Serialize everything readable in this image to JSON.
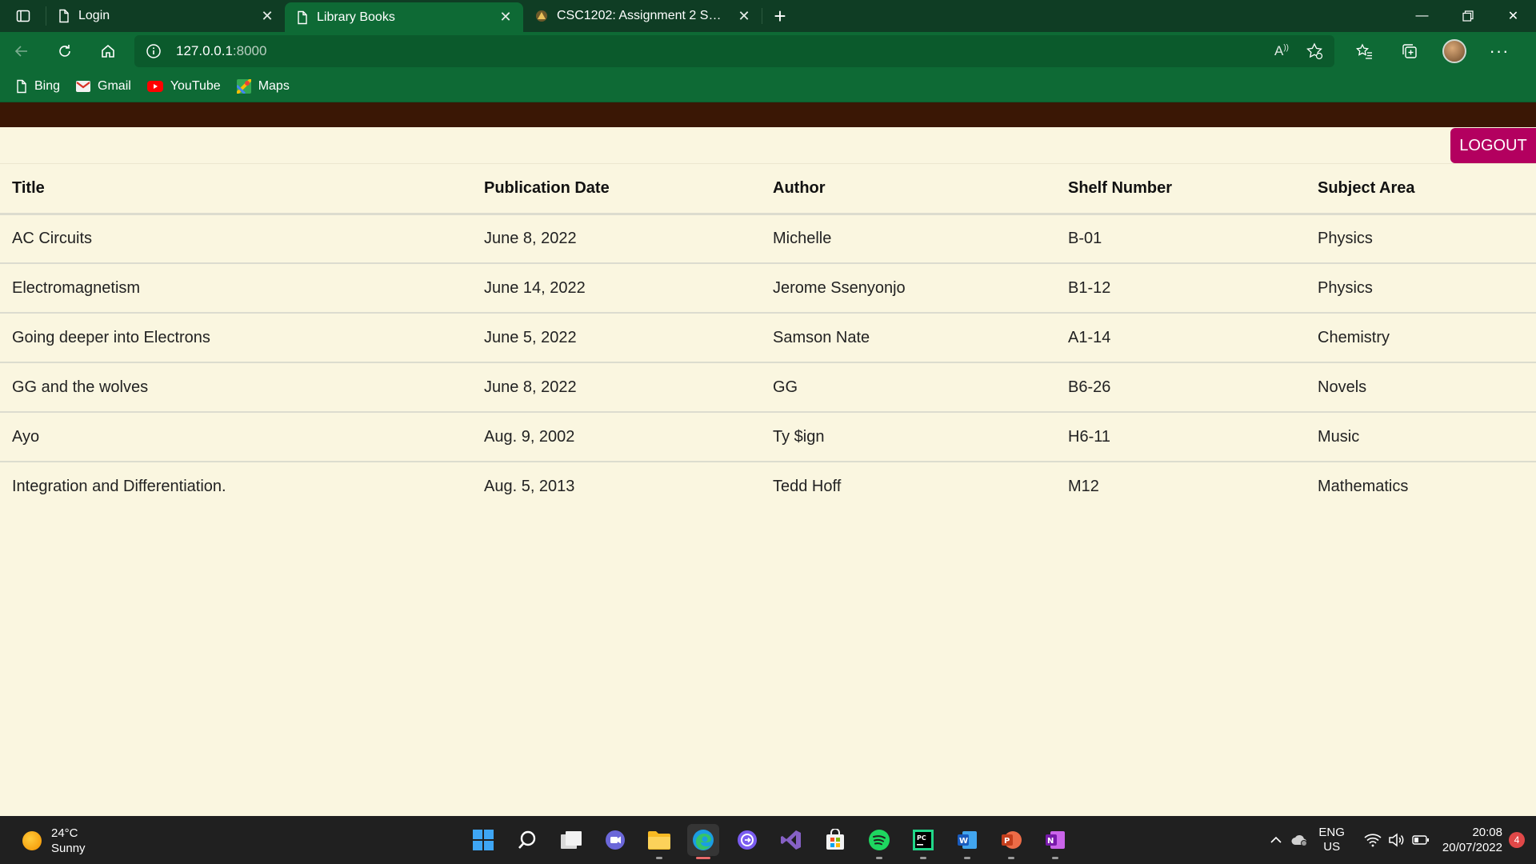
{
  "browser": {
    "tabs": [
      {
        "title": "Login",
        "active": false
      },
      {
        "title": "Library Books",
        "active": true
      },
      {
        "title": "CSC1202: Assignment 2 Submiss",
        "active": false
      }
    ],
    "address": {
      "host": "127.0.0.1",
      "port": ":8000"
    },
    "bookmarks": [
      "Bing",
      "Gmail",
      "YouTube",
      "Maps"
    ]
  },
  "page": {
    "logout_label": "LOGOUT",
    "columns": [
      "Title",
      "Publication Date",
      "Author",
      "Shelf Number",
      "Subject Area"
    ],
    "rows": [
      [
        "AC Circuits",
        "June 8, 2022",
        "Michelle",
        "B-01",
        "Physics"
      ],
      [
        "Electromagnetism",
        "June 14, 2022",
        "Jerome Ssenyonjo",
        "B1-12",
        "Physics"
      ],
      [
        "Going deeper into Electrons",
        "June 5, 2022",
        "Samson Nate",
        "A1-14",
        "Chemistry"
      ],
      [
        "GG and the wolves",
        "June 8, 2022",
        "GG",
        "B6-26",
        "Novels"
      ],
      [
        "Ayo",
        "Aug. 9, 2002",
        "Ty $ign",
        "H6-11",
        "Music"
      ],
      [
        "Integration and Differentiation.",
        "Aug. 5, 2013",
        "Tedd Hoff",
        "M12",
        "Mathematics"
      ]
    ]
  },
  "taskbar": {
    "weather": {
      "temp": "24°C",
      "condition": "Sunny"
    },
    "language": {
      "lang": "ENG",
      "region": "US"
    },
    "clock": {
      "time": "20:08",
      "date": "20/07/2022"
    },
    "notifications": "4"
  },
  "colors": {
    "tabbar": "#0f3d24",
    "toolbar": "#0e6a35",
    "site_header": "#3a1705",
    "page_bg": "#faf6e0",
    "logout": "#b3005f",
    "taskbar": "#202020"
  }
}
